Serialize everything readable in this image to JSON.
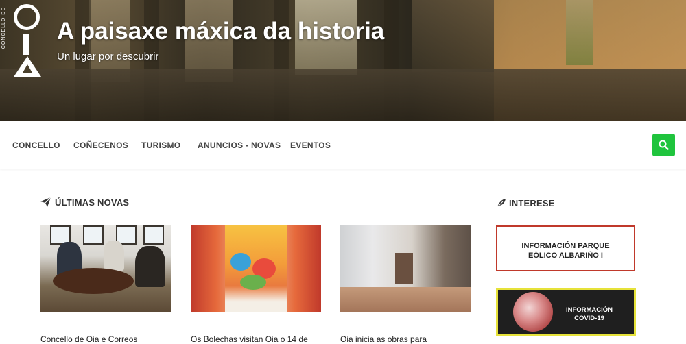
{
  "header": {
    "logo_text": "OIA",
    "logo_vertical_text": "CONCELLO DE",
    "title": "A paisaxe máxica da historia",
    "tagline": "Un lugar por descubrir"
  },
  "nav": {
    "items": [
      "CONCELLO",
      "COÑECENOS",
      "TURISMO",
      "ANUNCIOS - NOVAS",
      "EVENTOS"
    ],
    "search_icon": "search-icon",
    "search_color": "#1fc43d"
  },
  "news": {
    "title": "ÚLTIMAS NOVAS",
    "icon": "paper-plane-icon",
    "cards": [
      {
        "title": "Concello de Oia e Correos"
      },
      {
        "title": "Os Bolechas visitan Oia o 14 de"
      },
      {
        "title": "Oia inicia as obras para"
      }
    ]
  },
  "interest": {
    "title": "INTERESE",
    "icon": "feather-icon",
    "box1": {
      "line1": "INFORMACIÓN PARQUE",
      "line2": "EÓLICO ALBARIÑO I",
      "border_color": "#c0392b"
    },
    "box2": {
      "line1": "INFORMACIÓN",
      "line2": "COVID-19",
      "border_color": "#e6e23a"
    }
  }
}
